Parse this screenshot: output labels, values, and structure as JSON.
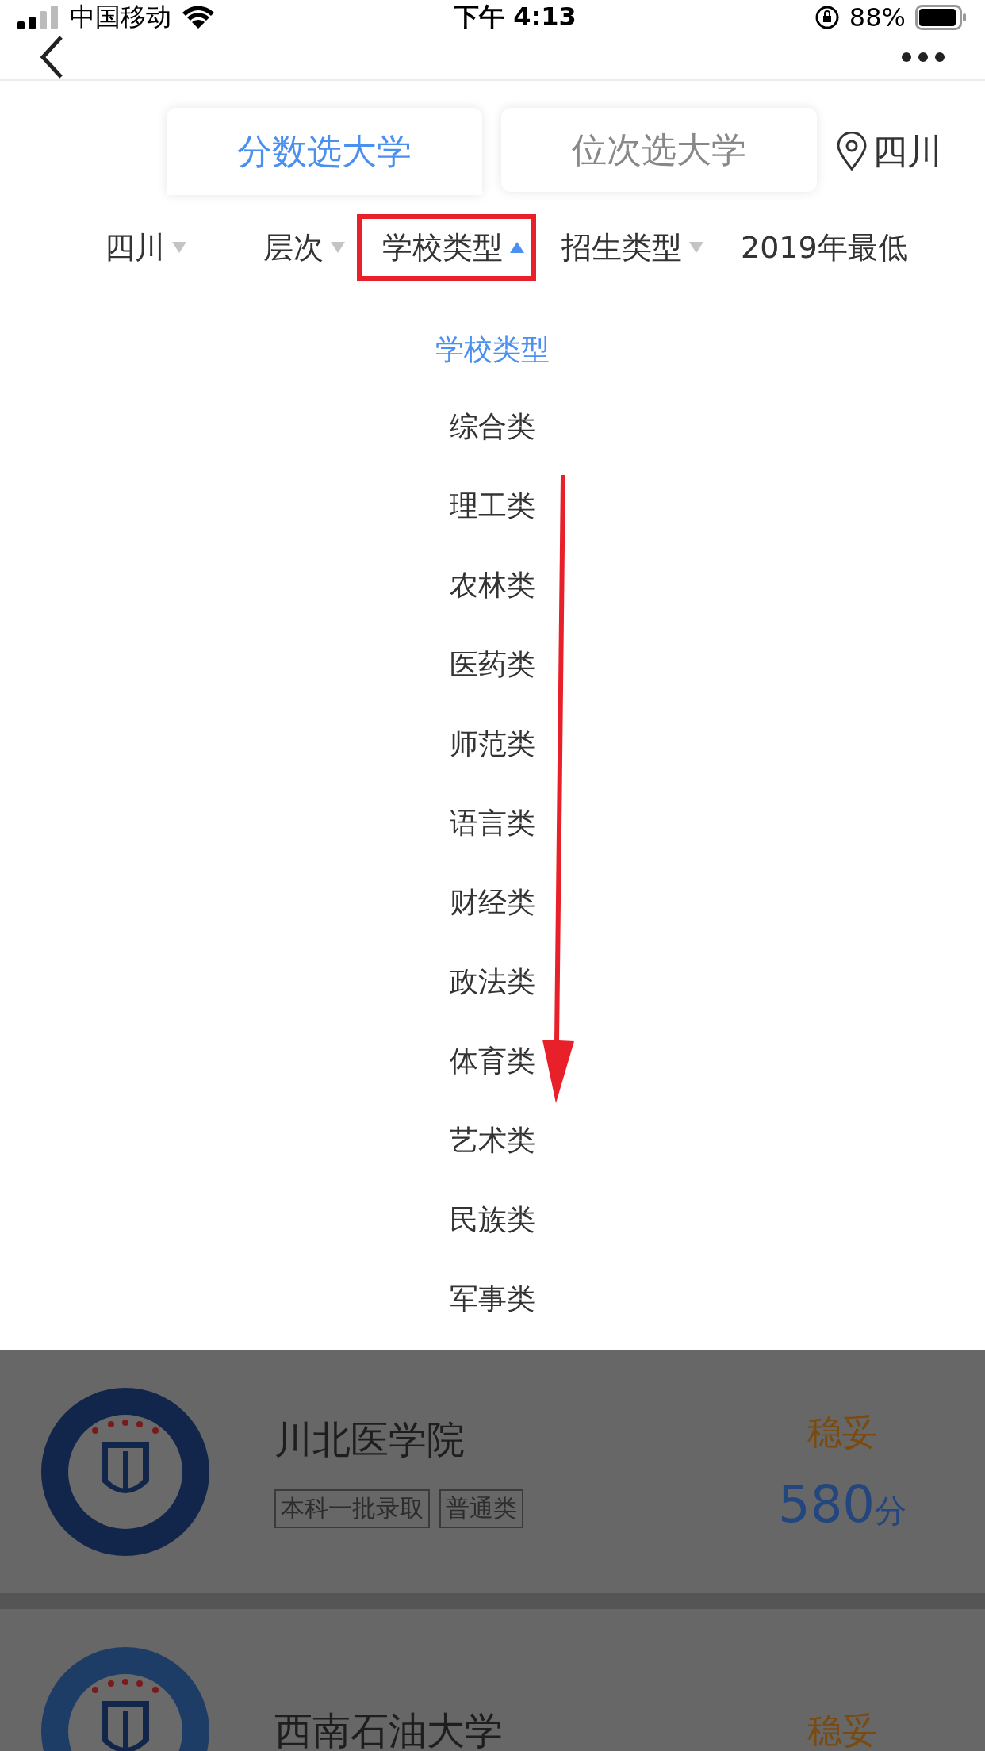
{
  "status_bar": {
    "carrier": "中国移动",
    "time": "下午 4:13",
    "battery": "88%"
  },
  "mode_tabs": [
    {
      "label": "分数选大学",
      "selected": true
    },
    {
      "label": "位次选大学",
      "selected": false
    }
  ],
  "location": "四川",
  "filters": [
    {
      "label": "四川",
      "expanded": false,
      "marked": false
    },
    {
      "label": "层次",
      "expanded": false,
      "marked": false
    },
    {
      "label": "学校类型",
      "expanded": true,
      "marked": true
    },
    {
      "label": "招生类型",
      "expanded": false,
      "marked": false
    },
    {
      "label": "2019年最低",
      "marked": false
    }
  ],
  "dropdown": {
    "title": "学校类型",
    "options": [
      "综合类",
      "理工类",
      "农林类",
      "医药类",
      "师范类",
      "语言类",
      "财经类",
      "政法类",
      "体育类",
      "艺术类",
      "民族类",
      "军事类"
    ]
  },
  "universities": [
    {
      "name": "川北医学院",
      "tags": [
        "本科一批录取",
        "普通类"
      ],
      "chance": "稳妥",
      "score": "580",
      "unit": "分"
    },
    {
      "name": "西南石油大学",
      "chance": "稳妥"
    }
  ]
}
